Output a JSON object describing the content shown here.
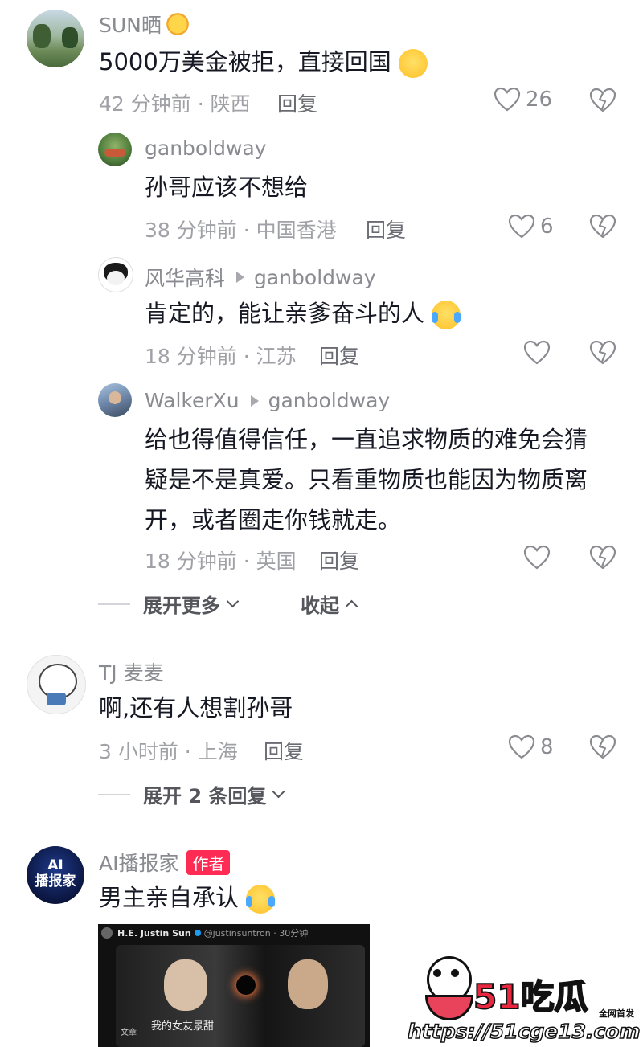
{
  "comments": [
    {
      "user": "SUN晒",
      "text": "5000万美金被拒，直接回国",
      "meta": "42 分钟前 · 陕西",
      "reply": "回复",
      "likes": "26"
    },
    {
      "user": "ganboldway",
      "text": "孙哥应该不想给",
      "meta": "38 分钟前 · 中国香港",
      "reply": "回复",
      "likes": "6"
    },
    {
      "user": "风华高科",
      "reply_to": "ganboldway",
      "text": "肯定的，能让亲爹奋斗的人",
      "meta": "18 分钟前 · 江苏",
      "reply": "回复"
    },
    {
      "user": "WalkerXu",
      "reply_to": "ganboldway",
      "text_lines": [
        "给也得值得信任，一直追求物质的难免会猜",
        "疑是不是真爱。只看重物质也能因为物质离",
        "开，或者圈走你钱就走。"
      ],
      "meta": "18 分钟前 · 英国",
      "reply": "回复"
    },
    {
      "user": "TJ 麦麦",
      "text": "啊,还有人想割孙哥",
      "meta": "3 小时前 · 上海",
      "reply": "回复",
      "likes": "8"
    },
    {
      "user": "AI播报家",
      "badge": "作者",
      "text": "男主亲自承认"
    }
  ],
  "expand1": {
    "more": "展开更多",
    "collapse": "收起"
  },
  "expand2": {
    "label": "展开 2 条回复"
  },
  "avatar_ai_text": "AI\n播报家",
  "preview": {
    "account": "H.E. Justin Sun",
    "handle": "@justinsuntron · 30分钟",
    "caption": "我的女友景甜",
    "label": "文章"
  },
  "watermark": {
    "brand": "51吃瓜",
    "tag": "全网首发",
    "url": "https://51cge13.com"
  },
  "colors": {
    "accent": "#fe2c55",
    "meta": "#a0a1a6"
  }
}
